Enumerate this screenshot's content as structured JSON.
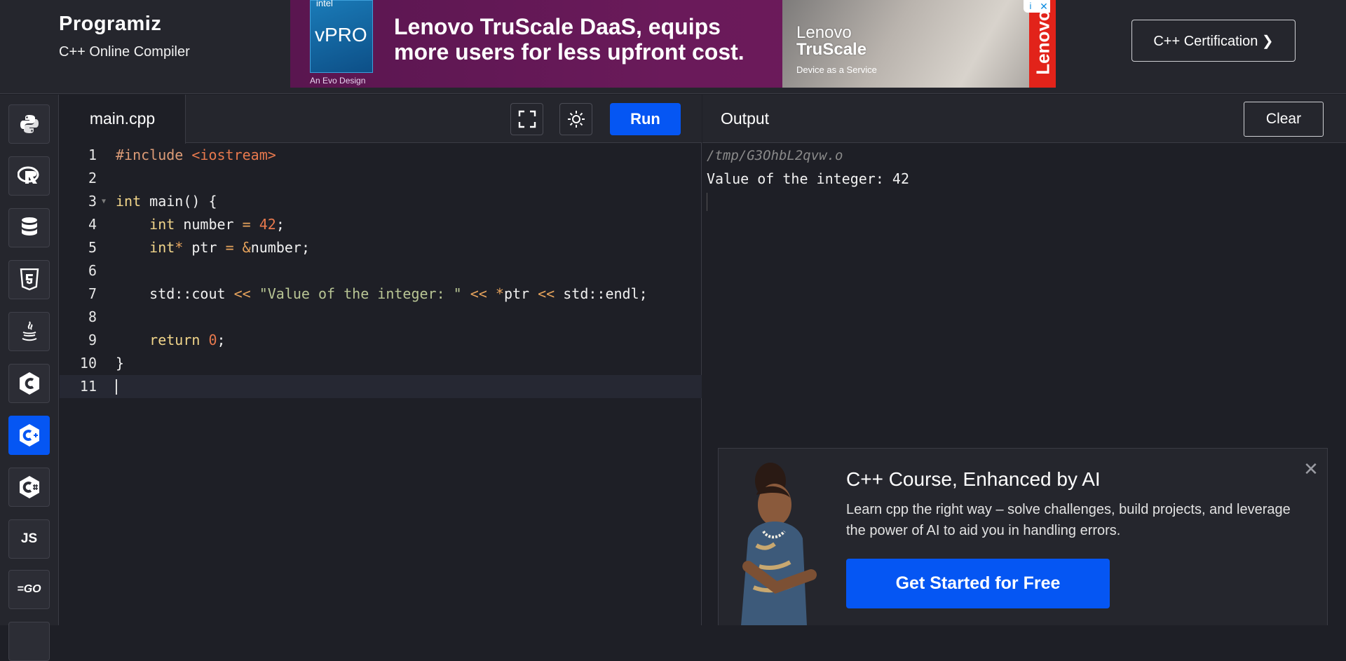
{
  "brand": {
    "logo": "Programiz",
    "subtitle": "C++ Online Compiler"
  },
  "ad": {
    "intel_label": "intel",
    "vpro_label": "vPRO",
    "evo_label": "An Evo Design",
    "headline": "Lenovo TruScale DaaS, equips more users for less upfront cost.",
    "photo_line1": "Lenovo",
    "photo_line2": "TruScale",
    "photo_small": "Device as a Service",
    "vertical_brand": "Lenovo",
    "info_icon": "i",
    "close_icon": "✕"
  },
  "header": {
    "certification_label": "C++ Certification ❯"
  },
  "sidebar": {
    "items": [
      {
        "icon": "python-icon",
        "glyph": ""
      },
      {
        "icon": "r-icon",
        "glyph": "R"
      },
      {
        "icon": "database-icon",
        "glyph": ""
      },
      {
        "icon": "html5-icon",
        "glyph": "5"
      },
      {
        "icon": "java-icon",
        "glyph": "☕"
      },
      {
        "icon": "c-icon",
        "glyph": "C"
      },
      {
        "icon": "cpp-icon",
        "glyph": "C+"
      },
      {
        "icon": "csharp-icon",
        "glyph": "C#"
      },
      {
        "icon": "javascript-icon",
        "glyph": "JS"
      },
      {
        "icon": "go-icon",
        "glyph": "=GO"
      }
    ],
    "active_index": 6,
    "active_color": "#0556f3"
  },
  "editor": {
    "file_tab": "main.cpp",
    "run_label": "Run",
    "fullscreen_icon": "fullscreen-icon",
    "theme_icon": "sun-icon",
    "lines": [
      "#include <iostream>",
      "",
      "int main() {",
      "    int number = 42;",
      "    int* ptr = &number;",
      "",
      "    std::cout << \"Value of the integer: \" << *ptr << std::endl;",
      "",
      "    return 0;",
      "}",
      ""
    ]
  },
  "output": {
    "title": "Output",
    "clear_label": "Clear",
    "path": "/tmp/G3OhbL2qvw.o",
    "text": "Value of the integer: 42"
  },
  "promo": {
    "title": "C++ Course, Enhanced by AI",
    "description": "Learn cpp the right way – solve challenges, build projects, and leverage the power of AI to aid you in handling errors.",
    "cta": "Get Started for Free",
    "close_icon": "✕"
  }
}
